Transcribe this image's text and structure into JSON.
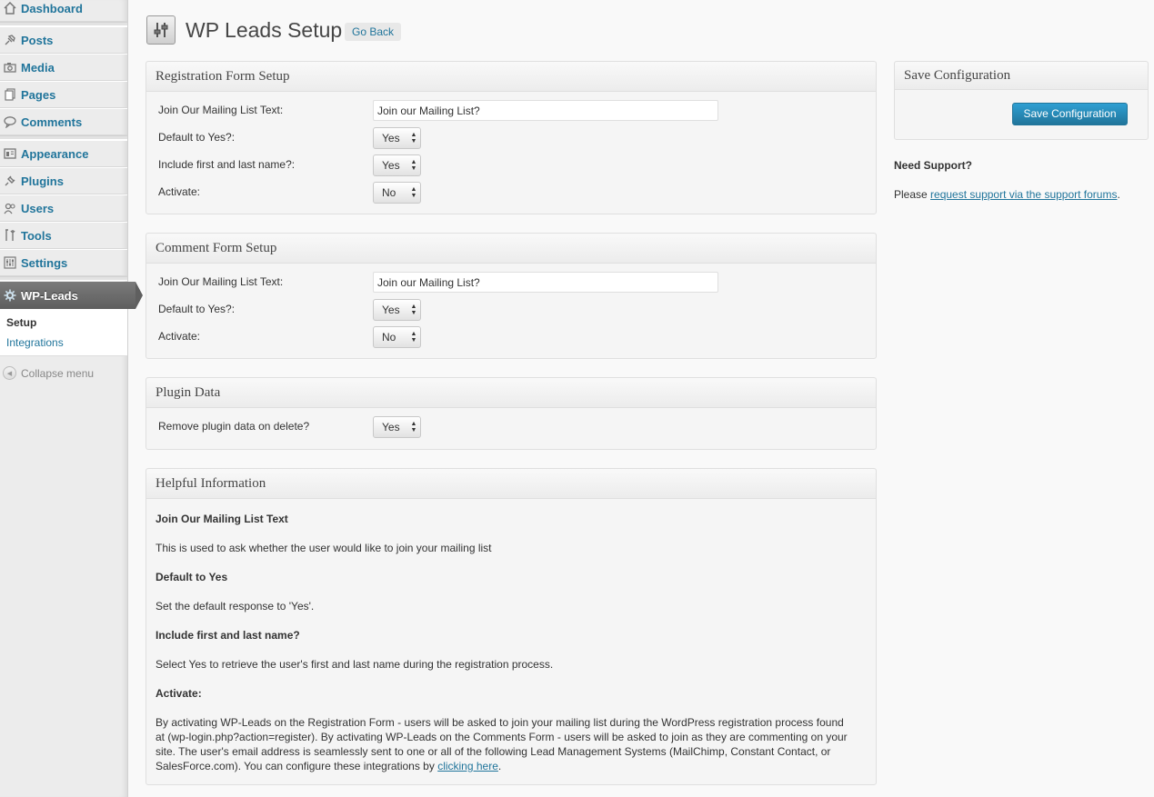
{
  "sidebar": {
    "items": [
      {
        "label": "Dashboard",
        "icon": "dashboard-icon"
      },
      {
        "label": "Posts",
        "icon": "pin-icon"
      },
      {
        "label": "Media",
        "icon": "camera-icon"
      },
      {
        "label": "Pages",
        "icon": "pages-icon"
      },
      {
        "label": "Comments",
        "icon": "comment-bubble-icon"
      },
      {
        "label": "Appearance",
        "icon": "appearance-icon"
      },
      {
        "label": "Plugins",
        "icon": "plug-icon"
      },
      {
        "label": "Users",
        "icon": "users-icon"
      },
      {
        "label": "Tools",
        "icon": "tools-icon"
      },
      {
        "label": "Settings",
        "icon": "settings-icon"
      },
      {
        "label": "WP-Leads",
        "icon": "gear-icon"
      }
    ],
    "submenu": [
      "Setup",
      "Integrations"
    ],
    "collapse_label": "Collapse menu"
  },
  "header": {
    "title": "WP Leads Setup",
    "go_back": "Go Back"
  },
  "registration": {
    "title": "Registration Form Setup",
    "mailing_label": "Join Our Mailing List Text:",
    "mailing_value": "Join our Mailing List?",
    "default_label": "Default to Yes?:",
    "default_value": "Yes",
    "name_label": "Include first and last name?:",
    "name_value": "Yes",
    "activate_label": "Activate:",
    "activate_value": "No"
  },
  "comment": {
    "title": "Comment Form Setup",
    "mailing_label": "Join Our Mailing List Text:",
    "mailing_value": "Join our Mailing List?",
    "default_label": "Default to Yes?:",
    "default_value": "Yes",
    "activate_label": "Activate:",
    "activate_value": "No"
  },
  "plugin_data": {
    "title": "Plugin Data",
    "remove_label": "Remove plugin data on delete?",
    "remove_value": "Yes"
  },
  "help": {
    "title": "Helpful Information",
    "h1": "Join Our Mailing List Text",
    "p1": "This is used to ask whether the user would like to join your mailing list",
    "h2": "Default to Yes",
    "p2": "Set the default response to 'Yes'.",
    "h3": "Include first and last name?",
    "p3": "Select Yes to retrieve the user's first and last name during the registration process.",
    "h4": "Activate:",
    "p4a": "By activating WP-Leads on the Registration Form - users will be asked to join your mailing list during the WordPress registration process found",
    "p4b": "at (wp-login.php?action=register). By activating WP-Leads on the Comments Form - users will be asked to join as they are commenting on your",
    "p4c": "site. The user's email address is seamlessly sent to one or all of the following Lead Management Systems (MailChimp, Constant Contact, or",
    "p4d": "SalesForce.com). You can configure these integrations by ",
    "p4_link": "clicking here",
    "p4_end": "."
  },
  "save": {
    "title": "Save Configuration",
    "button": "Save Configuration"
  },
  "support": {
    "title": "Need Support?",
    "prefix": "Please ",
    "link": "request support via the support forums",
    "suffix": "."
  }
}
